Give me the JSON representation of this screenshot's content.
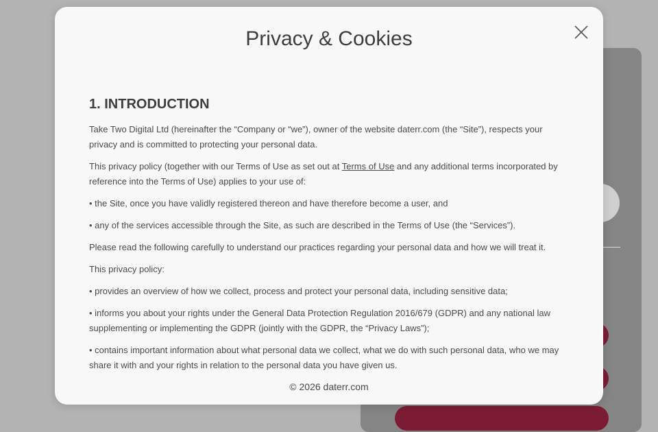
{
  "modal": {
    "title": "Privacy & Cookies",
    "close_icon": "close-icon",
    "section_heading": "1. INTRODUCTION",
    "paragraphs": [
      "Take Two Digital Ltd (hereinafter the “Company or “we”), owner of the website daterr.com (the “Site”), respects your privacy and is committed to protecting your personal data.",
      "This privacy policy (together with our Terms of Use as set out at ",
      "• the Site, once you have validly registered thereon and have therefore become a user, and",
      "• any of the services accessible through the Site, as such are described in the Terms of Use (the “Services”).",
      "Please read the following carefully to understand our practices regarding your personal data and how we will treat it.",
      "This privacy policy:",
      "• provides an overview of how we collect, process and protect your personal data, including sensitive data;",
      "• informs you about your rights under the General Data Protection Regulation 2016/679 (GDPR) and any national law supplementing or implementing the GDPR (jointly with the GDPR, the “Privacy Laws”);",
      "• contains important information about what personal data we collect, what we do with such personal data, who we may share it with and your rights in relation to the personal data you have given us."
    ],
    "terms_link_text": "Terms of Use",
    "paragraph_2_tail": " and any additional terms incorporated by reference into the Terms of Use) applies to your use of:",
    "footer": "© 2026 daterr.com"
  },
  "colors": {
    "overlay": "#b3b3b3",
    "modal_bg": "#f8f8f8",
    "accent": "#7b1c34"
  }
}
